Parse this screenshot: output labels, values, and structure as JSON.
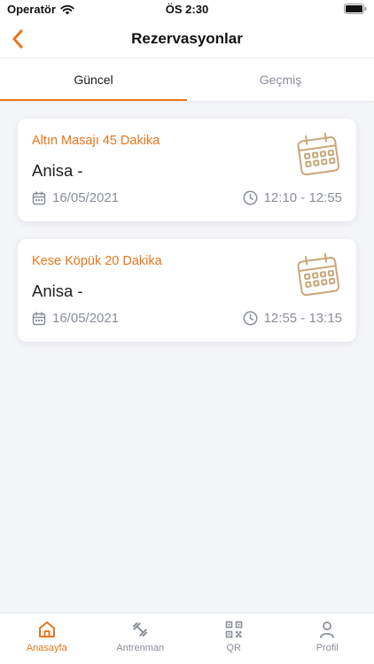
{
  "status_bar": {
    "carrier": "Operatör",
    "time": "ÖS 2:30"
  },
  "header": {
    "title": "Rezervasyonlar",
    "back_icon": "chevron-left-icon"
  },
  "tabs": [
    {
      "label": "Güncel",
      "active": true
    },
    {
      "label": "Geçmiş",
      "active": false
    }
  ],
  "reservations": [
    {
      "service": "Altın Masajı 45 Dakika",
      "person": "Anisa -",
      "date": "16/05/2021",
      "time_range": "12:10 - 12:55"
    },
    {
      "service": "Kese Köpük 20 Dakika",
      "person": "Anisa -",
      "date": "16/05/2021",
      "time_range": "12:55 - 13:15"
    }
  ],
  "bottom_nav": [
    {
      "label": "Anasayfa",
      "icon": "home-icon",
      "active": true
    },
    {
      "label": "Antrenman",
      "icon": "dumbbell-icon",
      "active": false
    },
    {
      "label": "QR",
      "icon": "qr-code-icon",
      "active": false
    },
    {
      "label": "Profil",
      "icon": "user-icon",
      "active": false
    }
  ],
  "colors": {
    "accent": "#e8761e",
    "muted": "#8a8f99",
    "background": "#f4f5f8",
    "calendar_illustration": "#c9a77a"
  }
}
